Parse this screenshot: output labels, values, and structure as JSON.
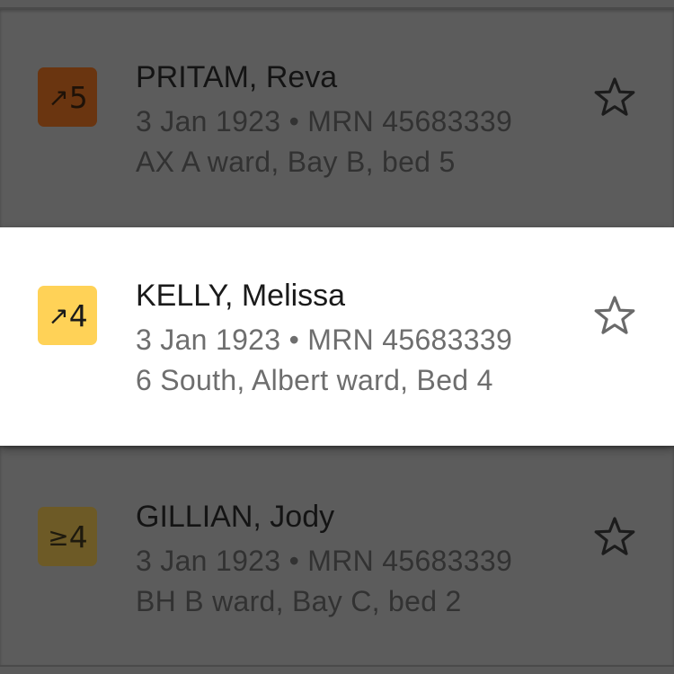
{
  "patients": [
    {
      "score": "5",
      "trend_symbol": "↗",
      "name": "PRITAM, Reva",
      "dob": "3 Jan 1923",
      "separator": "•",
      "mrn_label": "MRN",
      "mrn": "45683339",
      "location": "AX A ward, Bay B, bed 5",
      "badge_color": "#6a3510",
      "badge_text_color": "#1e1208",
      "state": "dimmed"
    },
    {
      "score": "4",
      "trend_symbol": "↗",
      "name": "KELLY, Melissa",
      "dob": "3 Jan 1923",
      "separator": "•",
      "mrn_label": "MRN",
      "mrn": "45683339",
      "location": "6 South, Albert ward, Bed 4",
      "badge_color": "#ffd257",
      "badge_text_color": "#1a1a1a",
      "state": "active"
    },
    {
      "score": "4",
      "trend_symbol": "≥",
      "name": "GILLIAN, Jody",
      "dob": "3 Jan 1923",
      "separator": "•",
      "mrn_label": "MRN",
      "mrn": "45683339",
      "location": "BH B ward, Bay C, bed 2",
      "badge_color": "#6d5a26",
      "badge_text_color": "#1e1a0e",
      "state": "dimmed"
    }
  ],
  "icons": {
    "favourite": "star-outline-icon"
  }
}
